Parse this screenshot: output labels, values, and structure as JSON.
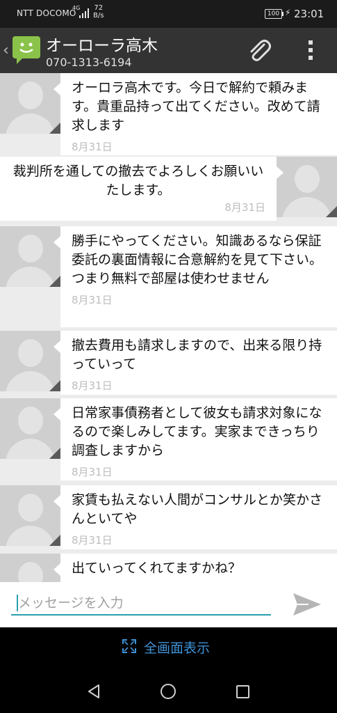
{
  "status_bar": {
    "carrier": "NTT DOCOMO",
    "network": "4G",
    "speed_value": "72",
    "speed_unit": "B/s",
    "battery": "100",
    "time": "23:01"
  },
  "header": {
    "contact_name": "オーローラ高木",
    "phone": "070-1313-6194",
    "icons": [
      "back-chevron-icon",
      "messaging-app-icon",
      "paperclip-icon",
      "more-vertical-icon"
    ]
  },
  "messages": [
    {
      "direction": "in",
      "text": "オーロラ高木です。今日で解約で頼みます。貴重品持って出てください。改めて請求します",
      "date": "8月31日"
    },
    {
      "direction": "out",
      "text": "裁判所を通しての撤去でよろしくお願いいたします。",
      "date": "8月31日"
    },
    {
      "direction": "in",
      "text": "勝手にやってください。知識あるなら保証委託の裏面情報に合意解約を見て下さい。つまり無料で部屋は使わせません",
      "date": "8月31日"
    },
    {
      "direction": "in",
      "text": "撤去費用も請求しますので、出来る限り持っていって",
      "date": "8月31日"
    },
    {
      "direction": "in",
      "text": "日常家事債務者として彼女も請求対象になるので楽しみしてます。実家まできっちり調査しますから",
      "date": "8月31日"
    },
    {
      "direction": "in",
      "text": "家賃も払えない人間がコンサルとか笑かさんといてや",
      "date": "8月31日"
    },
    {
      "direction": "in",
      "text": "出ていってくれてますかね？",
      "date": ""
    }
  ],
  "compose": {
    "placeholder": "メッセージを入力",
    "value": ""
  },
  "fullscreen": {
    "label": "全画面表示"
  },
  "colors": {
    "header_bg": "#333333",
    "list_bg": "#ececec",
    "accent": "#2a9fb0",
    "app_icon": "#8bc34a",
    "fullscreen_link": "#3f93d9"
  }
}
